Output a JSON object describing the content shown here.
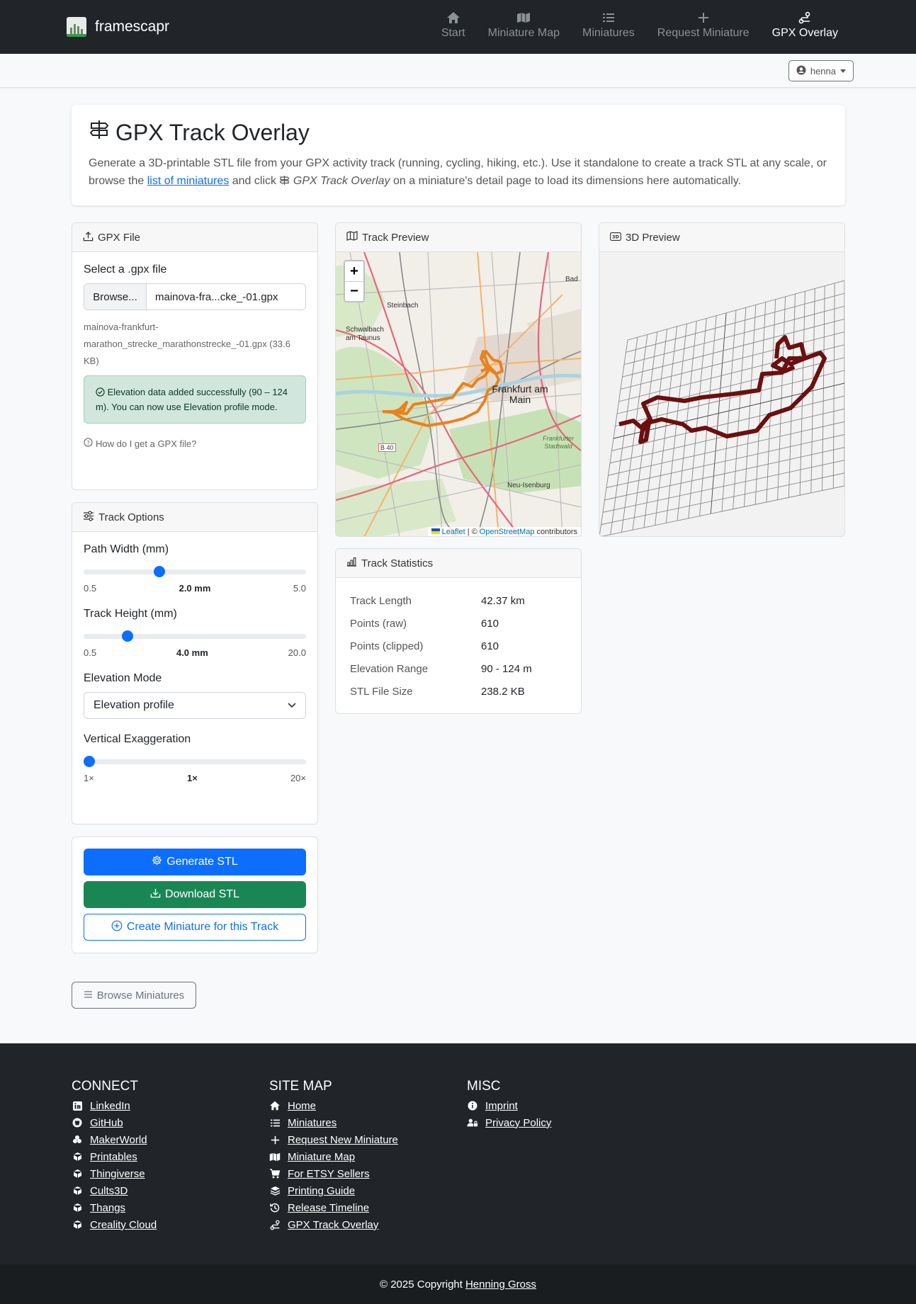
{
  "brand": {
    "name": "framescapr"
  },
  "nav": [
    {
      "label": "Start",
      "icon": "home-icon"
    },
    {
      "label": "Miniature Map",
      "icon": "map-icon"
    },
    {
      "label": "Miniatures",
      "icon": "list-icon"
    },
    {
      "label": "Request Miniature",
      "icon": "plus-icon"
    },
    {
      "label": "GPX Overlay",
      "icon": "route-icon",
      "active": true
    }
  ],
  "user": {
    "name": "henna"
  },
  "intro": {
    "title": "GPX Track Overlay",
    "text_before_link": "Generate a 3D-printable STL file from your GPX activity track (running, cycling, hiking, etc.). Use it standalone to create a track STL at any scale, or browse the ",
    "link": "list of miniatures",
    "text_after_link": " and click ",
    "italic": "GPX Track Overlay",
    "text_end": " on a miniature's detail page to load its dimensions here automatically."
  },
  "gpx_file": {
    "header": "GPX File",
    "select_label": "Select a .gpx file",
    "browse": "Browse...",
    "file_display": "mainova-fra...cke_-01.gpx",
    "file_full": "mainova-frankfurt-marathon_strecke_marathonstrecke_-01.gpx (33.6 KB)",
    "alert": "Elevation data added successfully (90 – 124 m). You can now use Elevation profile mode.",
    "help": "How do I get a GPX file?"
  },
  "track_options": {
    "header": "Track Options",
    "path_width": {
      "label": "Path Width (mm)",
      "min": "0.5",
      "max": "5.0",
      "value_label": "2.0 mm",
      "fraction": 0.333
    },
    "track_height": {
      "label": "Track Height (mm)",
      "min": "0.5",
      "max": "20.0",
      "value_label": "4.0 mm",
      "fraction": 0.18
    },
    "elevation_mode": {
      "label": "Elevation Mode",
      "selected": "Elevation profile"
    },
    "vertical_exaggeration": {
      "label": "Vertical Exaggeration",
      "min": "1×",
      "max": "20×",
      "value_label": "1×",
      "fraction": 0.0
    }
  },
  "actions": {
    "generate": "Generate STL",
    "download": "Download STL",
    "create": "Create Miniature for this Track"
  },
  "browse_button": "Browse Miniatures",
  "track_preview": {
    "header": "Track Preview",
    "zoom_in": "+",
    "zoom_out": "−",
    "places": [
      "Steinbach",
      "Schwalbach am Taunus",
      "Bad",
      "Frankfurt am Main",
      "Frankfurter Stadtwald",
      "Neu-Isenburg",
      "B 40"
    ],
    "attribution": {
      "leaflet": "Leaflet",
      "sep": "| ©",
      "osm": "OpenStreetMap",
      "contrib": "contributors"
    }
  },
  "preview_3d": {
    "header": "3D Preview",
    "track_color": "#6b0f0f"
  },
  "stats": {
    "header": "Track Statistics",
    "rows": [
      {
        "k": "Track Length",
        "v": "42.37 km"
      },
      {
        "k": "Points (raw)",
        "v": "610"
      },
      {
        "k": "Points (clipped)",
        "v": "610"
      },
      {
        "k": "Elevation Range",
        "v": "90 - 124 m"
      },
      {
        "k": "STL File Size",
        "v": "238.2 KB"
      }
    ]
  },
  "footer": {
    "connect": {
      "title": "CONNECT",
      "items": [
        "LinkedIn",
        "GitHub",
        "MakerWorld",
        "Printables",
        "Thingiverse",
        "Cults3D",
        "Thangs",
        "Creality Cloud"
      ]
    },
    "sitemap": {
      "title": "SITE MAP",
      "items": [
        "Home",
        "Miniatures",
        "Request New Miniature",
        "Miniature Map",
        "For ETSY Sellers",
        "Printing Guide",
        "Release Timeline",
        "GPX Track Overlay"
      ]
    },
    "misc": {
      "title": "MISC",
      "items": [
        "Imprint",
        "Privacy Policy"
      ]
    },
    "copyright_text": "© 2025 Copyright",
    "copyright_name": "Henning Gross"
  },
  "colors": {
    "primary": "#0d6efd",
    "success": "#198754",
    "navbar": "#212529",
    "track": "#e8821e"
  }
}
